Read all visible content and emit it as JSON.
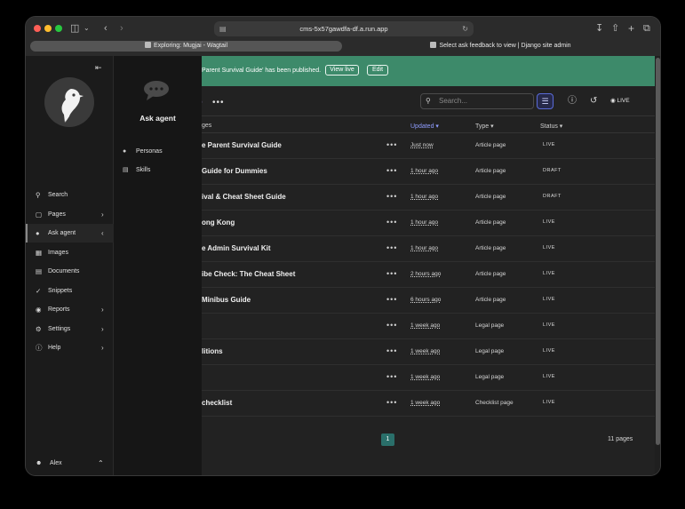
{
  "browser": {
    "address": "cms-5x57gawdfa-df.a.run.app",
    "tabs": [
      {
        "label": "Exploring: Mugjai - Wagtail",
        "active": true
      },
      {
        "label": "Select ask feedback to view | Django site admin",
        "active": false
      }
    ]
  },
  "banner": {
    "message": "Parent Survival Guide' has been published.",
    "view_live": "View live",
    "edit": "Edit",
    "color": "#3d8a6a"
  },
  "toolbar": {
    "search_placeholder": "Search...",
    "live_label": "LIVE"
  },
  "table": {
    "columns": {
      "title": "ges",
      "updated": "Updated",
      "type": "Type",
      "status": "Status"
    },
    "rows": [
      {
        "title": "e Parent Survival Guide",
        "updated": "Just now",
        "type": "Article page",
        "status": "LIVE"
      },
      {
        "title": "Guide for Dummies",
        "updated": "1 hour ago",
        "type": "Article page",
        "status": "DRAFT"
      },
      {
        "title": "ival & Cheat Sheet Guide",
        "updated": "1 hour ago",
        "type": "Article page",
        "status": "DRAFT"
      },
      {
        "title": "ong Kong",
        "updated": "1 hour ago",
        "type": "Article page",
        "status": "LIVE"
      },
      {
        "title": "e Admin Survival Kit",
        "updated": "1 hour ago",
        "type": "Article page",
        "status": "LIVE"
      },
      {
        "title": "ibe Check: The Cheat Sheet",
        "updated": "2 hours ago",
        "type": "Article page",
        "status": "LIVE"
      },
      {
        "title": "Minibus Guide",
        "updated": "6 hours ago",
        "type": "Article page",
        "status": "LIVE"
      },
      {
        "title": "",
        "updated": "1 week ago",
        "type": "Legal page",
        "status": "LIVE"
      },
      {
        "title": "litions",
        "updated": "1 week ago",
        "type": "Legal page",
        "status": "LIVE"
      },
      {
        "title": "",
        "updated": "1 week ago",
        "type": "Legal page",
        "status": "LIVE"
      },
      {
        "title": "checklist",
        "updated": "1 week ago",
        "type": "Checklist page",
        "status": "LIVE"
      }
    ]
  },
  "pagination": {
    "current": "1",
    "total_label": "11 pages"
  },
  "sidebar": {
    "items": [
      {
        "label": "Search",
        "icon": "search-icon"
      },
      {
        "label": "Pages",
        "icon": "pages-icon"
      },
      {
        "label": "Ask agent",
        "icon": "chat-icon"
      },
      {
        "label": "Images",
        "icon": "image-icon"
      },
      {
        "label": "Documents",
        "icon": "document-icon"
      },
      {
        "label": "Snippets",
        "icon": "snippet-icon"
      },
      {
        "label": "Reports",
        "icon": "globe-icon"
      },
      {
        "label": "Settings",
        "icon": "cog-icon"
      },
      {
        "label": "Help",
        "icon": "help-icon"
      }
    ],
    "user": "Alex"
  },
  "subpanel": {
    "title": "Ask agent",
    "items": [
      {
        "label": "Personas",
        "icon": "user-icon"
      },
      {
        "label": "Skills",
        "icon": "doc-icon"
      }
    ]
  }
}
